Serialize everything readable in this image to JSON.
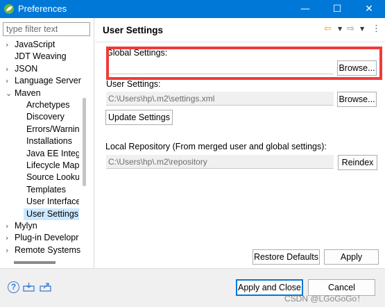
{
  "window": {
    "title": "Preferences",
    "minimize_glyph": "—",
    "maximize_glyph": "☐",
    "close_glyph": "✕"
  },
  "sidebar": {
    "filter_placeholder": "type filter text",
    "items": [
      {
        "label": "JavaScript",
        "arrow": "›"
      },
      {
        "label": "JDT Weaving",
        "arrow": ""
      },
      {
        "label": "JSON",
        "arrow": "›"
      },
      {
        "label": "Language Server",
        "arrow": "›"
      },
      {
        "label": "Maven",
        "arrow": "⌄"
      },
      {
        "label": "Archetypes",
        "arrow": ""
      },
      {
        "label": "Discovery",
        "arrow": ""
      },
      {
        "label": "Errors/Warnin",
        "arrow": ""
      },
      {
        "label": "Installations",
        "arrow": ""
      },
      {
        "label": "Java EE Integra",
        "arrow": ""
      },
      {
        "label": "Lifecycle Map",
        "arrow": ""
      },
      {
        "label": "Source Looku",
        "arrow": ""
      },
      {
        "label": "Templates",
        "arrow": ""
      },
      {
        "label": "User Interface",
        "arrow": ""
      },
      {
        "label": "User Settings",
        "arrow": ""
      },
      {
        "label": "Mylyn",
        "arrow": "›"
      },
      {
        "label": "Plug-in Developr",
        "arrow": "›"
      },
      {
        "label": "Remote Systems",
        "arrow": "›"
      }
    ],
    "selected_item": "User Settings"
  },
  "main": {
    "title": "User Settings",
    "global_settings": {
      "label": "Global Settings:",
      "value": "",
      "browse_label": "Browse..."
    },
    "user_settings": {
      "label": "User Settings:",
      "value": "C:\\Users\\hp\\.m2\\settings.xml",
      "browse_label": "Browse..."
    },
    "update_settings_label": "Update Settings",
    "local_repository": {
      "label": "Local Repository (From merged user and global settings):",
      "value": "C:\\Users\\hp\\.m2\\repository",
      "reindex_label": "Reindex"
    },
    "restore_defaults_label": "Restore Defaults",
    "apply_label": "Apply"
  },
  "footer": {
    "apply_close_label": "Apply and Close",
    "cancel_label": "Cancel",
    "help_glyph": "?",
    "watermark": "CSDN @LGoGoGo！"
  },
  "colors": {
    "title_bar": "#0078d7",
    "selection": "#cce8ff",
    "highlight_box": "#ef3a3a"
  }
}
